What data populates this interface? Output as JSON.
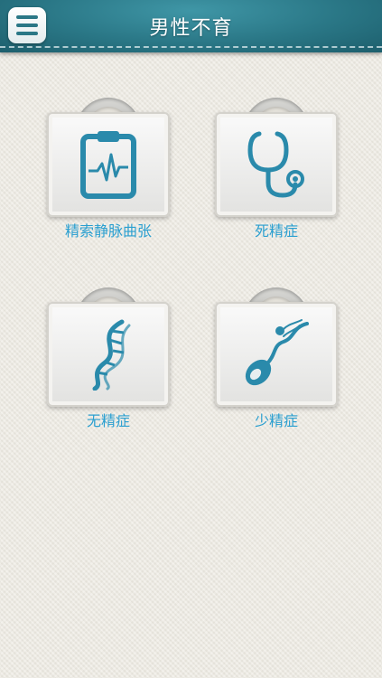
{
  "header": {
    "title": "男性不育",
    "menu_icon": "menu-icon"
  },
  "categories": [
    {
      "label": "精索静脉曲张",
      "icon": "clipboard-heartbeat-icon"
    },
    {
      "label": "死精症",
      "icon": "stethoscope-icon"
    },
    {
      "label": "无精症",
      "icon": "dna-icon"
    },
    {
      "label": "少精症",
      "icon": "sperm-icon"
    }
  ],
  "colors": {
    "header": "#2a7786",
    "icon": "#2a8aab",
    "label": "#2a9fd0",
    "background": "#ebe8e0"
  }
}
